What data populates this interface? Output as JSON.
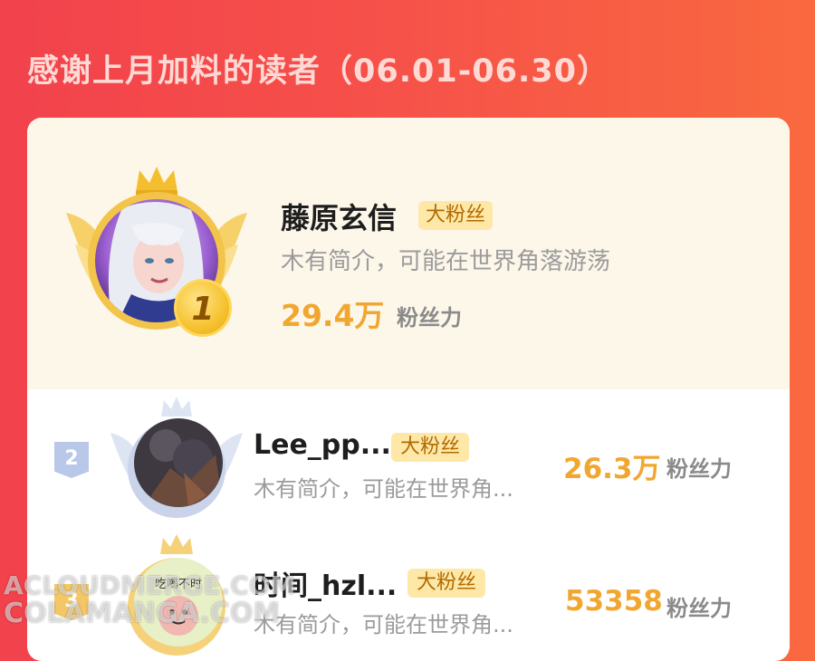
{
  "header": {
    "title": "感谢上月加料的读者（06.01-06.30）"
  },
  "ranking": [
    {
      "rank": "1",
      "name": "藤原玄信",
      "badge": "大粉丝",
      "bio": "木有简介，可能在世界角落游荡",
      "score": "29.4万",
      "unit": "粉丝力"
    },
    {
      "rank": "2",
      "name": "Lee_pp...",
      "badge": "大粉丝",
      "bio": "木有简介，可能在世界角...",
      "score": "26.3万",
      "unit": "粉丝力"
    },
    {
      "rank": "3",
      "name": "时间_hzl...",
      "badge": "大粉丝",
      "bio": "木有简介，可能在世界角...",
      "score": "53358",
      "unit": "粉丝力"
    }
  ],
  "avatar3_text": "吃喝不时",
  "watermark": {
    "line1": "ACLOUDMERGE.COM",
    "line2": "COLAMANGA.COM"
  },
  "colors": {
    "accent_red": "#f2424c",
    "score_gold": "#f1a72f",
    "badge_bg": "#fde8a8"
  },
  "icons": [
    "crown-icon",
    "wing-icon",
    "rank-medal-icon",
    "rank-badge-icon"
  ]
}
